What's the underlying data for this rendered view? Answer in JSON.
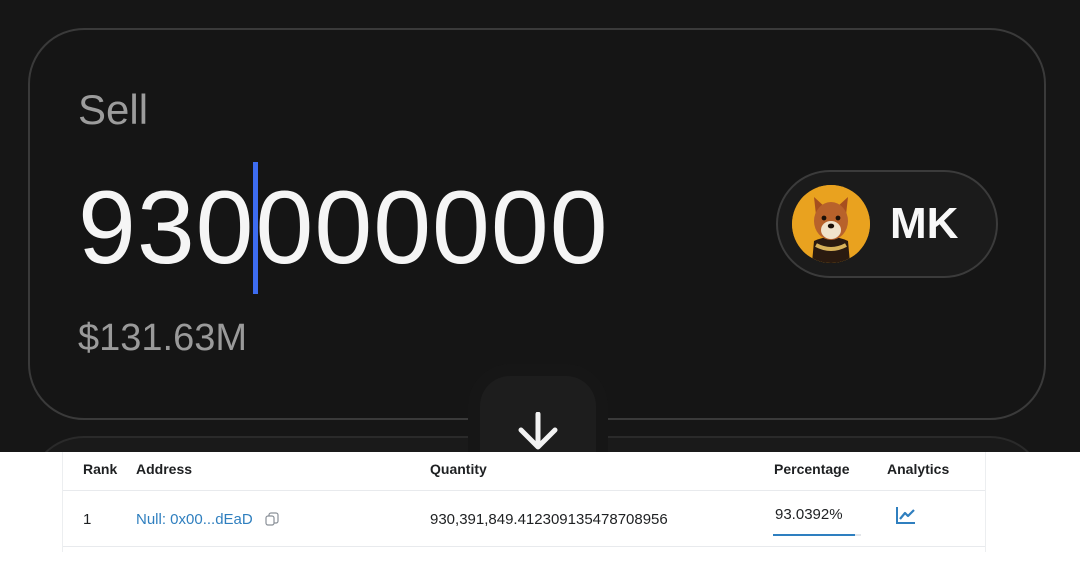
{
  "swap": {
    "sell_label": "Sell",
    "amount_before_caret": "930",
    "amount_after_caret": "000000",
    "usd_value": "$131.63M",
    "token_symbol": "MK"
  },
  "holders_table": {
    "headers": {
      "rank": "Rank",
      "address": "Address",
      "quantity": "Quantity",
      "percentage": "Percentage",
      "analytics": "Analytics"
    },
    "rows": [
      {
        "rank": "1",
        "address": "Null: 0x00...dEaD",
        "quantity": "930,391,849.412309135478708956",
        "percentage": "93.0392%",
        "percentage_value": 0.930392
      }
    ]
  },
  "colors": {
    "caret": "#3d6cf0",
    "link": "#2f7fbf",
    "token_avatar_bg": "#e9a21f"
  }
}
